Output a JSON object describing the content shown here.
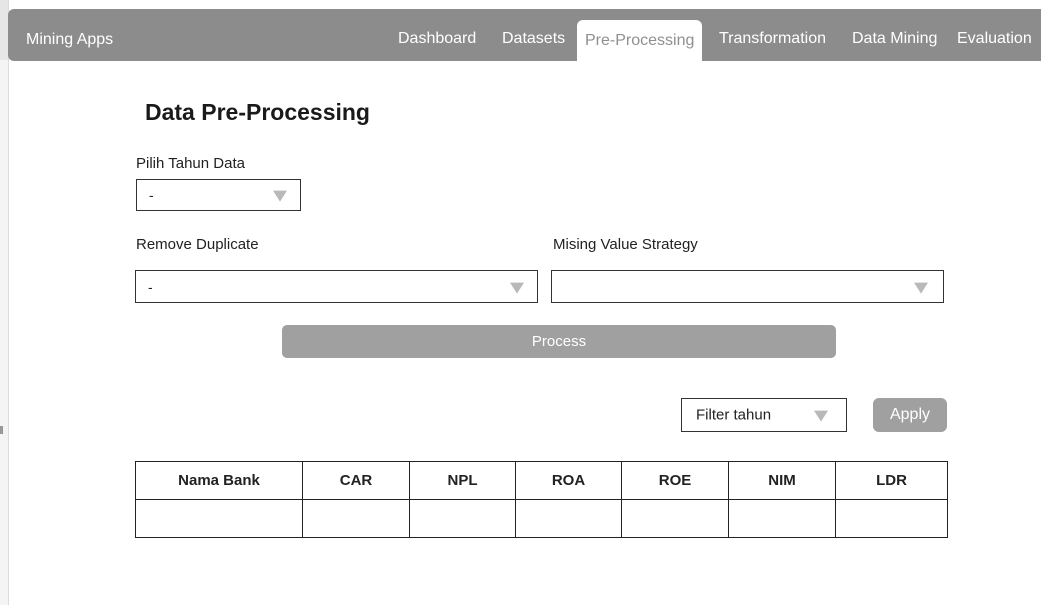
{
  "navbar": {
    "brand": "Mining Apps",
    "tabs": [
      {
        "label": "Dashboard",
        "active": false
      },
      {
        "label": "Datasets",
        "active": false
      },
      {
        "label": "Pre-Processing",
        "active": true
      },
      {
        "label": "Transformation",
        "active": false
      },
      {
        "label": "Data Mining",
        "active": false
      },
      {
        "label": "Evaluation",
        "active": false
      }
    ]
  },
  "page": {
    "title": "Data Pre-Processing"
  },
  "form": {
    "year_label": "Pilih Tahun Data",
    "year_value": "-",
    "duplicate_label": "Remove Duplicate",
    "duplicate_value": "-",
    "missing_label": "Mising Value Strategy",
    "missing_value": "",
    "process_label": "Process"
  },
  "filter": {
    "select_value": "Filter tahun",
    "apply_label": "Apply"
  },
  "table": {
    "columns": [
      "Nama Bank",
      "CAR",
      "NPL",
      "ROA",
      "ROE",
      "NIM",
      "LDR"
    ],
    "rows": [
      [
        "",
        "",
        "",
        "",
        "",
        "",
        ""
      ]
    ]
  },
  "colors": {
    "navbar": "#8c8c8c",
    "button": "#a0a0a0",
    "active_tab_text": "#8f8f8f"
  }
}
